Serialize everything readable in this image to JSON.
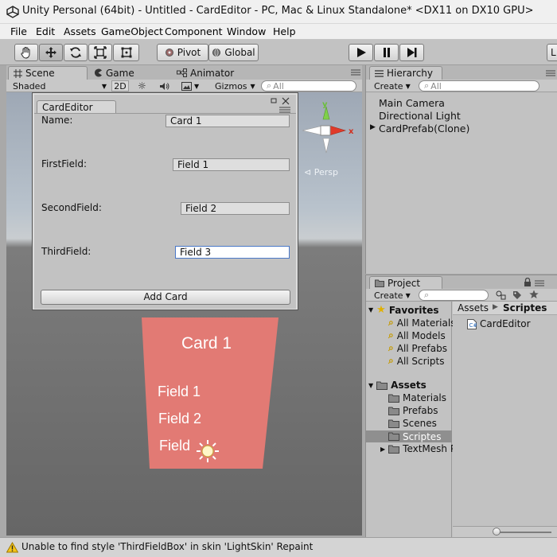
{
  "window": {
    "title": "Unity Personal (64bit) - Untitled - CardEditor - PC, Mac & Linux Standalone* <DX11 on DX10 GPU>"
  },
  "menu": [
    "File",
    "Edit",
    "Assets",
    "GameObject",
    "Component",
    "Window",
    "Help"
  ],
  "toolbar": {
    "pivot_label": "Pivot",
    "global_label": "Global",
    "layers_label": "L"
  },
  "scene": {
    "tabs": [
      "Scene",
      "Game",
      "Animator"
    ],
    "shading_mode": "Shaded",
    "mode_2d": "2D",
    "gizmos_label": "Gizmos",
    "search_placeholder": "All",
    "persp_label": "Persp",
    "gizmo_axes": {
      "y": "y",
      "x": "x"
    }
  },
  "card": {
    "title": "Card 1",
    "field1": "Field 1",
    "field2": "Field 2",
    "field3": "Field",
    "color": "#e27a74"
  },
  "card_editor": {
    "tab_title": "CardEditor",
    "name_label": "Name:",
    "name_value": "Card 1",
    "first_label": "FirstField:",
    "first_value": "Field 1",
    "second_label": "SecondField:",
    "second_value": "Field 2",
    "third_label": "ThirdField:",
    "third_value": "Field 3",
    "add_button": "Add Card"
  },
  "hierarchy": {
    "tab": "Hierarchy",
    "create_label": "Create",
    "search_placeholder": "All",
    "items": [
      "Main Camera",
      "Directional Light",
      "CardPrefab(Clone)"
    ]
  },
  "project": {
    "tab": "Project",
    "create_label": "Create",
    "favorites_label": "Favorites",
    "favorites": [
      "All Materials",
      "All Models",
      "All Prefabs",
      "All Scripts"
    ],
    "assets_label": "Assets",
    "folders": [
      "Materials",
      "Prefabs",
      "Scenes",
      "Scriptes",
      "TextMesh P"
    ],
    "breadcrumb_root": "Assets",
    "breadcrumb_current": "Scriptes",
    "files": [
      "CardEditor"
    ]
  },
  "status": {
    "message": "Unable to find style 'ThirdFieldBox' in skin 'LightSkin' Repaint"
  }
}
